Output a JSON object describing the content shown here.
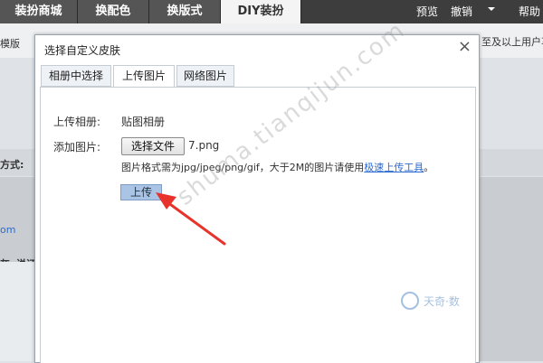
{
  "topbar": {
    "tabs": [
      "装扮商城",
      "换配色",
      "换版式",
      "DIY装扮"
    ],
    "right": [
      "预览",
      "撤销",
      "帮助"
    ]
  },
  "background": {
    "left_texts": [
      "模版",
      "方式:",
      "om",
      "灰",
      "说证"
    ],
    "right_text": "至及以上用户享"
  },
  "dialog": {
    "title": "选择自定义皮肤",
    "close": "×",
    "tabs": [
      "相册中选择",
      "上传图片",
      "网络图片"
    ],
    "upload_album_label": "上传相册:",
    "upload_album_value": "贴图相册",
    "add_image_label": "添加图片:",
    "choose_file_button": "选择文件",
    "file_name": "7.png",
    "format_hint": "图片格式需为jpg/jpeg/png/gif，大于2M的图片请使用",
    "fast_upload_link": "极速上传工具",
    "hint_end": "。",
    "upload_button": "上传"
  },
  "overlay": {
    "watermark": "shuma.tianqijun.com",
    "logo": "天奇·数"
  },
  "colors": {
    "arrow": "#e8322c",
    "topbar": "#3d3d3d",
    "link": "#2b6bd1",
    "upload_button": "#aac4e6"
  }
}
